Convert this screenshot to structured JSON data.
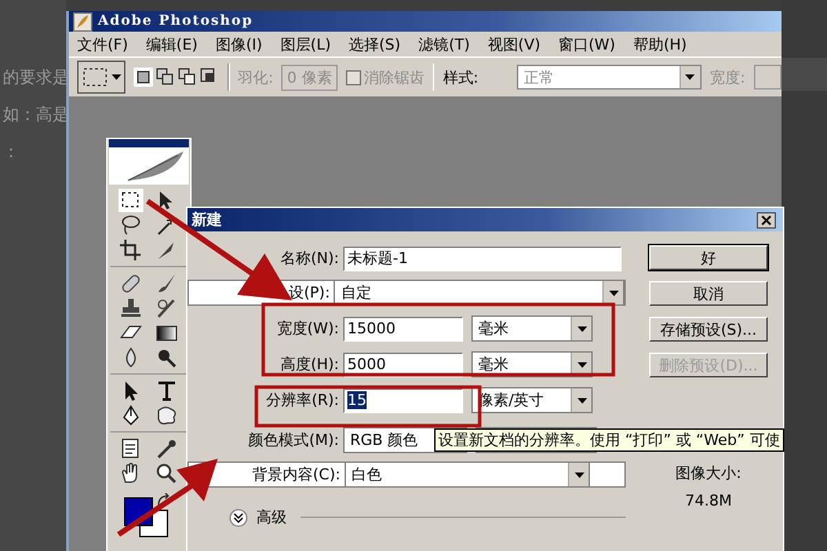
{
  "background_page": {
    "lines": [
      "的要求是",
      "如：高是",
      "："
    ]
  },
  "window": {
    "title": "Adobe Photoshop"
  },
  "menu": [
    {
      "label": "文件(F)"
    },
    {
      "label": "编辑(E)"
    },
    {
      "label": "图像(I)"
    },
    {
      "label": "图层(L)"
    },
    {
      "label": "选择(S)"
    },
    {
      "label": "滤镜(T)"
    },
    {
      "label": "视图(V)"
    },
    {
      "label": "窗口(W)"
    },
    {
      "label": "帮助(H)"
    }
  ],
  "options_bar": {
    "feather_label": "羽化:",
    "feather_value": "0 像素",
    "feather_disabled": true,
    "antialias": {
      "label": "消除锯齿",
      "checked": false,
      "disabled": true
    },
    "style_label": "样式:",
    "style_value": "正常",
    "width_label": "宽度:"
  },
  "dialog": {
    "title": "新建",
    "fields": [
      {
        "kind": "text",
        "label": "名称(N):",
        "value": "未标题-1"
      },
      {
        "kind": "select",
        "label": "设(P):",
        "value": "自定"
      },
      {
        "kind": "unit",
        "label": "宽度(W):",
        "value": "15000",
        "unit": "毫米",
        "selected": false
      },
      {
        "kind": "unit",
        "label": "高度(H):",
        "value": "5000",
        "unit": "毫米",
        "selected": false
      },
      {
        "kind": "unit",
        "label": "分辨率(R):",
        "value": "15",
        "unit": "像素/英寸",
        "selected": true
      },
      {
        "kind": "mode",
        "label": "颜色模式(M):",
        "value": "RGB 颜色"
      },
      {
        "kind": "select",
        "label": "背景内容(C):",
        "value": "白色"
      }
    ],
    "buttons": [
      {
        "label": "好",
        "default": true,
        "disabled": false
      },
      {
        "label": "取消",
        "default": false,
        "disabled": false
      },
      {
        "label": "存储预设(S)...",
        "default": false,
        "disabled": false
      },
      {
        "label": "删除预设(D)...",
        "default": false,
        "disabled": true
      }
    ],
    "image_size": {
      "label": "图像大小:",
      "value": "74.8M"
    },
    "advanced": {
      "label": "高级",
      "expanded": false
    },
    "tooltip": "设置新文档的分辨率。使用 “打印” 或 “Web” 可使"
  }
}
